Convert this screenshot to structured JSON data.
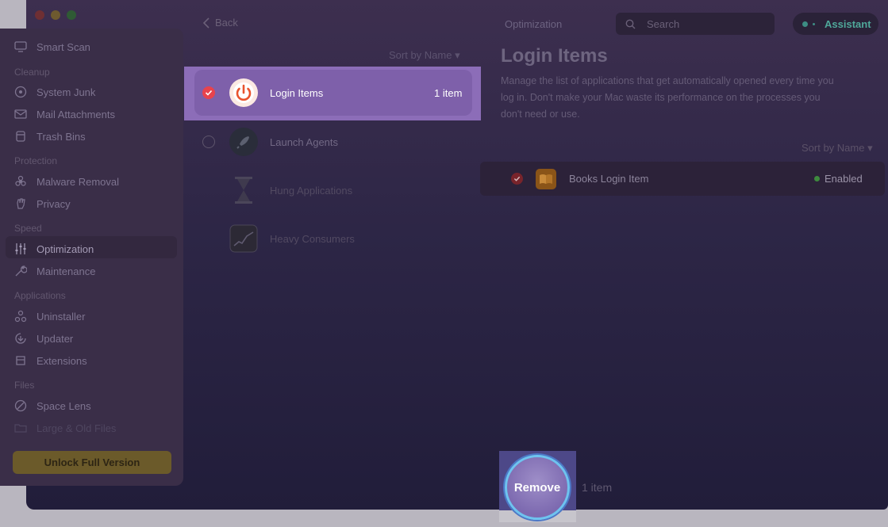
{
  "toolbar": {
    "back_label": "Back",
    "section_title": "Optimization",
    "search_placeholder": "Search",
    "assistant_label": "Assistant"
  },
  "sidebar": {
    "items": [
      {
        "label": "Smart Scan",
        "icon": "monitor-icon"
      },
      {
        "label": "System Junk",
        "icon": "disk-icon"
      },
      {
        "label": "Mail Attachments",
        "icon": "mail-icon"
      },
      {
        "label": "Trash Bins",
        "icon": "trash-icon"
      },
      {
        "label": "Malware Removal",
        "icon": "biohazard-icon"
      },
      {
        "label": "Privacy",
        "icon": "hand-icon"
      },
      {
        "label": "Optimization",
        "icon": "sliders-icon"
      },
      {
        "label": "Maintenance",
        "icon": "wrench-icon"
      },
      {
        "label": "Uninstaller",
        "icon": "uninstaller-icon"
      },
      {
        "label": "Updater",
        "icon": "updater-icon"
      },
      {
        "label": "Extensions",
        "icon": "extensions-icon"
      },
      {
        "label": "Space Lens",
        "icon": "lens-icon"
      },
      {
        "label": "Large & Old Files",
        "icon": "folder-icon"
      }
    ],
    "sections": [
      "Cleanup",
      "Protection",
      "Speed",
      "Applications",
      "Files"
    ],
    "active": "Optimization",
    "unlock_label": "Unlock Full Version"
  },
  "middle": {
    "sort_label": "Sort by Name ▾",
    "rows": [
      {
        "label": "Login Items",
        "count": "1 item",
        "checked": true
      },
      {
        "label": "Launch Agents",
        "checked": false
      },
      {
        "label": "Hung Applications"
      },
      {
        "label": "Heavy Consumers"
      }
    ]
  },
  "detail": {
    "title": "Login Items",
    "description": "Manage the list of applications that get automatically opened every time you log in. Don't make your Mac waste its performance on the processes you don't need or use.",
    "sort_label": "Sort by Name ▾",
    "items": [
      {
        "name": "Books Login Item",
        "status": "Enabled",
        "checked": true
      }
    ]
  },
  "footer": {
    "remove_label": "Remove",
    "count_label": "1 item"
  },
  "colors": {
    "accent_purple": "#8c6db8",
    "checkbox_red": "#e8434d",
    "unlock_gold": "#6b5a2a",
    "assistant_teal": "#4fa89a",
    "status_green": "#3e8a3e"
  }
}
